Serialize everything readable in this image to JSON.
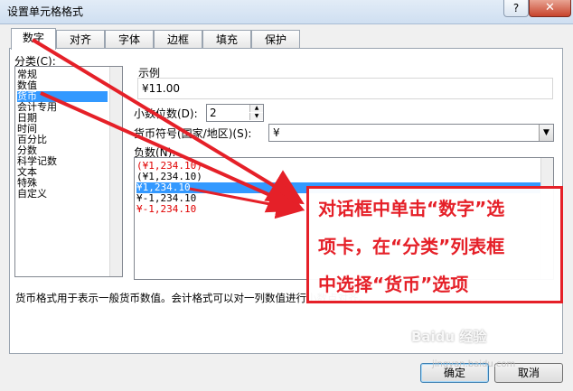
{
  "dialog": {
    "title": "设置单元格格式",
    "help": "?",
    "close": "✕"
  },
  "tabs": [
    "数字",
    "对齐",
    "字体",
    "边框",
    "填充",
    "保护"
  ],
  "category": {
    "label": "分类(C):",
    "items": [
      "常规",
      "数值",
      "货币",
      "会计专用",
      "日期",
      "时间",
      "百分比",
      "分数",
      "科学记数",
      "文本",
      "特殊",
      "自定义"
    ],
    "selected_index": 2
  },
  "sample": {
    "label": "示例",
    "value": "¥11.00"
  },
  "decimals": {
    "label": "小数位数(D):",
    "value": "2"
  },
  "currency_symbol": {
    "label": "货币符号(国家/地区)(S):",
    "value": "¥"
  },
  "negative": {
    "label": "负数(N):",
    "items": [
      {
        "text": "(¥1,234.10)",
        "color": "red"
      },
      {
        "text": "(¥1,234.10)",
        "color": "black"
      },
      {
        "text": "¥1,234.10",
        "color": "red",
        "selected": true
      },
      {
        "text": "¥-1,234.10",
        "color": "black"
      },
      {
        "text": "¥-1,234.10",
        "color": "red"
      }
    ]
  },
  "description": "货币格式用于表示一般货币数值。会计格式可以对一列数值进行小数点对齐。",
  "buttons": {
    "ok": "确定",
    "cancel": "取消"
  },
  "annotation": {
    "lines": [
      "对话框中单击“数字”选",
      "项卡，在“分类”列表框",
      "中选择“货币”选项"
    ],
    "color": "#e52028"
  },
  "watermark": {
    "text": "Baidu 经验",
    "sub": "jingyan.baidu.com"
  },
  "colors": {
    "accent_red": "#e52028",
    "selection": "#3399ff"
  }
}
